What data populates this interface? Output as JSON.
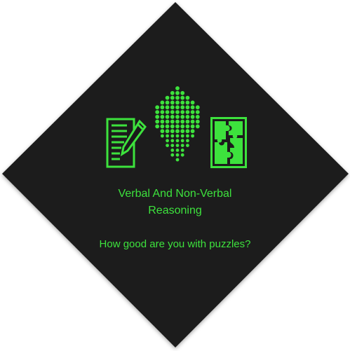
{
  "title_line1": "Verbal And Non-Verbal",
  "title_line2": "Reasoning",
  "subtitle": "How good are you with puzzles?",
  "colors": {
    "background": "#1a1a1a",
    "accent": "#3de23d",
    "page": "#ffffff"
  },
  "icons": [
    "document-pencil-icon",
    "dot-diamond-icon",
    "puzzle-icon"
  ]
}
